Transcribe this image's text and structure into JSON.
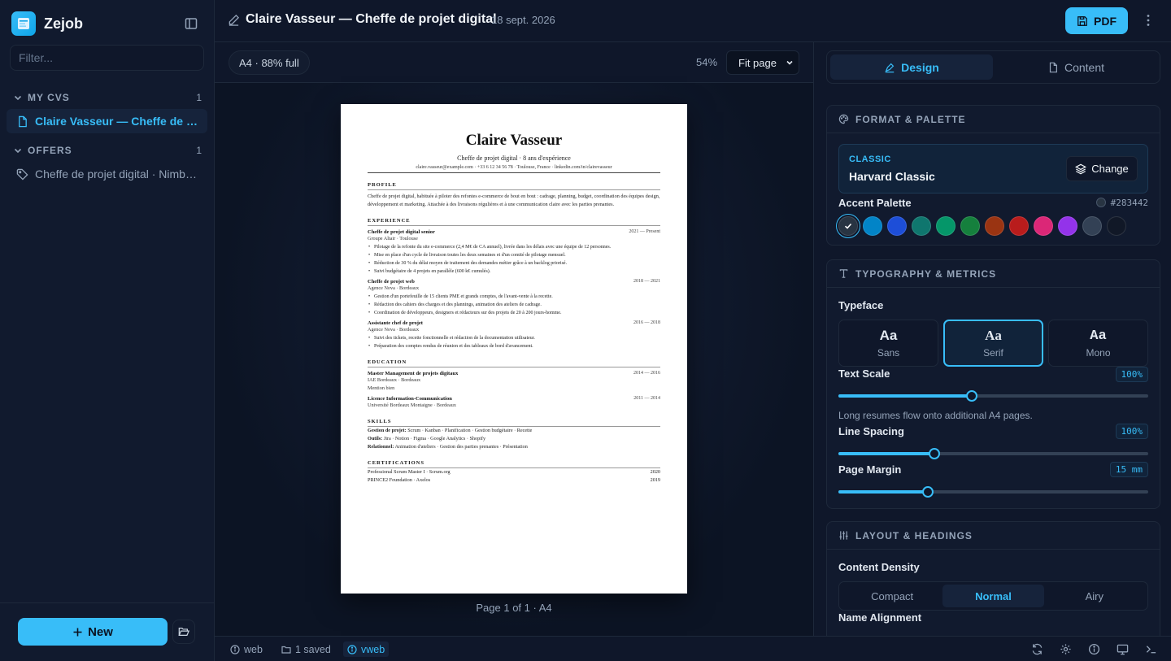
{
  "app": {
    "name": "Zejob"
  },
  "sidebar": {
    "filter_placeholder": "Filter...",
    "sections": [
      {
        "label": "MY CVS",
        "count": "1",
        "items": [
          {
            "label": "Claire Vasseur — Cheffe de projet digital"
          }
        ]
      },
      {
        "label": "OFFERS",
        "count": "1",
        "items": [
          {
            "label": "Cheffe de projet digital · Nimbus Digital"
          }
        ]
      }
    ],
    "new_label": "New"
  },
  "topbar": {
    "title": "Claire Vasseur — Cheffe de projet digital",
    "date": "18 sept. 2026",
    "pdf_label": "PDF"
  },
  "preview": {
    "fill_badge": "A4 · 88% full",
    "zoom": "54%",
    "fit_option": "Fit page",
    "page_info": "Page 1 of 1 · A4"
  },
  "cv": {
    "name": "Claire Vasseur",
    "tagline": "Cheffe de projet digital · 8 ans d'expérience",
    "contact": "claire.vasseur@example.com  ·  +33 6 12 34 56 78  ·  Toulouse, France  ·  linkedin.com/in/clairevasseur",
    "profile_title": "PROFILE",
    "profile": "Cheffe de projet digital, habituée à piloter des refontes e-commerce de bout en bout : cadrage, planning, budget, coordination des équipes design, développement et marketing. Attachée à des livraisons régulières et à une communication claire avec les parties prenantes.",
    "experience_title": "EXPERIENCE",
    "experience": [
      {
        "role": "Cheffe de projet digital senior",
        "dates": "2021 — Present",
        "org": "Groupe Altair · Toulouse",
        "bullets": [
          "Pilotage de la refonte du site e-commerce (2,4 M€ de CA annuel), livrée dans les délais avec une équipe de 12 personnes.",
          "Mise en place d'un cycle de livraison toutes les deux semaines et d'un comité de pilotage mensuel.",
          "Réduction de 30 % du délai moyen de traitement des demandes métier grâce à un backlog priorisé.",
          "Suivi budgétaire de 4 projets en parallèle (600 k€ cumulés)."
        ]
      },
      {
        "role": "Cheffe de projet web",
        "dates": "2018 — 2021",
        "org": "Agence Nova · Bordeaux",
        "bullets": [
          "Gestion d'un portefeuille de 15 clients PME et grands comptes, de l'avant-vente à la recette.",
          "Rédaction des cahiers des charges et des plannings, animation des ateliers de cadrage.",
          "Coordination de développeurs, designers et rédacteurs sur des projets de 20 à 200 jours-homme."
        ]
      },
      {
        "role": "Assistante chef de projet",
        "dates": "2016 — 2018",
        "org": "Agence Nova · Bordeaux",
        "bullets": [
          "Suivi des tickets, recette fonctionnelle et rédaction de la documentation utilisateur.",
          "Préparation des comptes rendus de réunion et des tableaux de bord d'avancement."
        ]
      }
    ],
    "education_title": "EDUCATION",
    "education": [
      {
        "degree": "Master Management de projets digitaux",
        "dates": "2014 — 2016",
        "school": "IAE Bordeaux · Bordeaux",
        "note": "Mention bien"
      },
      {
        "degree": "Licence Information-Communication",
        "dates": "2011 — 2014",
        "school": "Université Bordeaux Montaigne · Bordeaux",
        "note": ""
      }
    ],
    "skills_title": "SKILLS",
    "skills": [
      {
        "cat": "Gestion de projet:",
        "list": "Scrum · Kanban · Planification · Gestion budgétaire · Recette"
      },
      {
        "cat": "Outils:",
        "list": "Jira · Notion · Figma · Google Analytics · Shopify"
      },
      {
        "cat": "Relationnel:",
        "list": "Animation d'ateliers · Gestion des parties prenantes · Présentation"
      }
    ],
    "cert_title": "CERTIFICATIONS",
    "certs": [
      {
        "name": "Professional Scrum Master I · Scrum.org",
        "year": "2020"
      },
      {
        "name": "PRINCE2 Foundation · Axelos",
        "year": "2019"
      }
    ]
  },
  "status": {
    "items": [
      "web",
      "1 saved",
      "vweb"
    ]
  },
  "panel": {
    "tabs": [
      "Design",
      "Content"
    ],
    "format": {
      "title": "FORMAT & PALETTE",
      "kind": "CLASSIC",
      "template": "Harvard Classic",
      "change_label": "Change",
      "accent_label": "Accent Palette",
      "accent_hex": "#283442",
      "swatches": [
        "#283442",
        "#0284c7",
        "#1d4ed8",
        "#0f766e",
        "#059669",
        "#15803d",
        "#9a3412",
        "#b91c1c",
        "#db2777",
        "#9333ea",
        "#334155",
        "#111827"
      ]
    },
    "typography": {
      "title": "TYPOGRAPHY & METRICS",
      "typeface_label": "Typeface",
      "faces": [
        {
          "aa": "Aa",
          "name": "Sans"
        },
        {
          "aa": "Aa",
          "name": "Serif"
        },
        {
          "aa": "Aa",
          "name": "Mono"
        }
      ],
      "selected_face": "Serif",
      "text_scale_label": "Text Scale",
      "text_scale": "100%",
      "text_scale_level": 0.43,
      "hint": "Long resumes flow onto additional A4 pages.",
      "line_spacing_label": "Line Spacing",
      "line_spacing": "100%",
      "line_spacing_level": 0.31,
      "margin_label": "Page Margin",
      "margin": "15 mm",
      "margin_level": 0.29
    },
    "layout": {
      "title": "LAYOUT & HEADINGS",
      "density_label": "Content Density",
      "density": [
        "Compact",
        "Normal",
        "Airy"
      ],
      "selected_density": "Normal",
      "alignment_label": "Name Alignment"
    }
  }
}
